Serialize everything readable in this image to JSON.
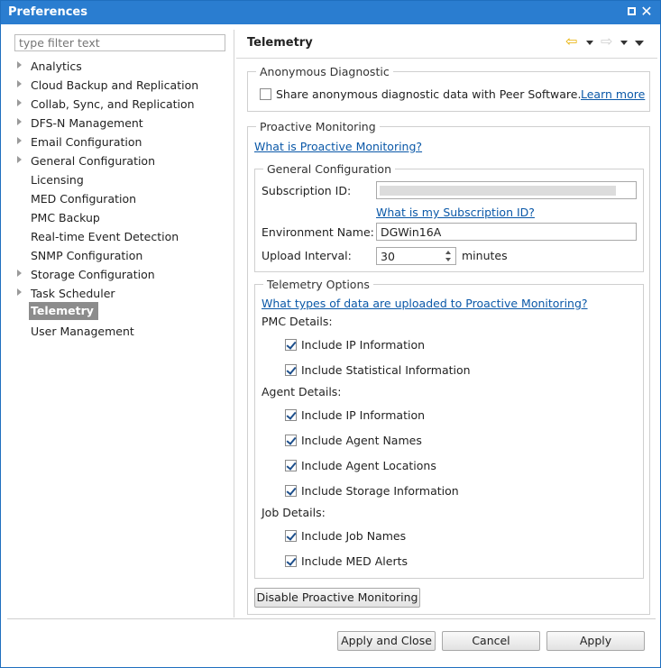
{
  "window": {
    "title": "Preferences"
  },
  "filter": {
    "placeholder": "type filter text"
  },
  "tree": {
    "items": [
      {
        "label": "Analytics",
        "expandable": true
      },
      {
        "label": "Cloud Backup and Replication",
        "expandable": true
      },
      {
        "label": "Collab, Sync, and Replication",
        "expandable": true
      },
      {
        "label": "DFS-N Management",
        "expandable": true
      },
      {
        "label": "Email Configuration",
        "expandable": true
      },
      {
        "label": "General Configuration",
        "expandable": true
      },
      {
        "label": "Licensing",
        "expandable": false
      },
      {
        "label": "MED Configuration",
        "expandable": false
      },
      {
        "label": "PMC Backup",
        "expandable": false
      },
      {
        "label": "Real-time Event Detection",
        "expandable": false
      },
      {
        "label": "SNMP Configuration",
        "expandable": false
      },
      {
        "label": "Storage Configuration",
        "expandable": true
      },
      {
        "label": "Task Scheduler",
        "expandable": true
      },
      {
        "label": "Telemetry",
        "expandable": false,
        "selected": true
      },
      {
        "label": "User Management",
        "expandable": false
      }
    ]
  },
  "page": {
    "title": "Telemetry",
    "nav": {
      "back_icon": "arrow-left-icon",
      "forward_icon": "arrow-right-icon"
    },
    "anonymous": {
      "legend": "Anonymous Diagnostic",
      "share_label": "Share anonymous diagnostic data with Peer Software.",
      "share_checked": false,
      "learn_more": "Learn more"
    },
    "proactive": {
      "legend": "Proactive Monitoring",
      "what_is_link": "What is Proactive Monitoring?",
      "general": {
        "legend": "General Configuration",
        "subscription_label": "Subscription ID:",
        "subscription_link": "What is my Subscription ID?",
        "environment_label": "Environment Name:",
        "environment_value": "DGWin16A",
        "upload_label": "Upload Interval:",
        "upload_value": "30",
        "upload_unit": "minutes"
      },
      "options": {
        "legend": "Telemetry Options",
        "types_link": "What types of data are uploaded to Proactive Monitoring?",
        "pmc_heading": "PMC Details:",
        "pmc_ip": "Include IP Information",
        "pmc_stats": "Include Statistical Information",
        "agent_heading": "Agent Details:",
        "agent_ip": "Include IP Information",
        "agent_names": "Include Agent Names",
        "agent_locations": "Include Agent Locations",
        "agent_storage": "Include Storage Information",
        "job_heading": "Job Details:",
        "job_names": "Include Job Names",
        "job_med": "Include MED Alerts"
      },
      "disable_button": "Disable Proactive Monitoring"
    }
  },
  "footer": {
    "apply_close": "Apply and Close",
    "cancel": "Cancel",
    "apply": "Apply"
  },
  "colors": {
    "titlebar": "#2a7dd0",
    "link": "#0a58a8",
    "selected": "#8c8c8c"
  }
}
